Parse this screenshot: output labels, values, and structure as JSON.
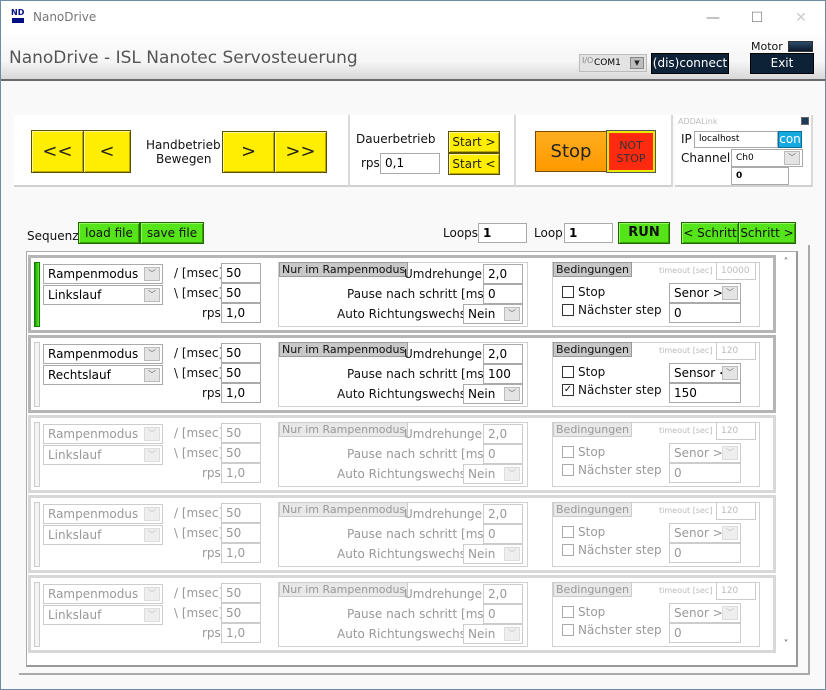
{
  "window": {
    "title": "NanoDrive",
    "icon_text": "ND",
    "controls": {
      "minimize": "—",
      "maximize": "☐",
      "close": "✕"
    }
  },
  "header": {
    "app_title": "NanoDrive - ISL Nanotec Servosteuerung",
    "com_port": {
      "io_glyph": "I/O",
      "value": "COM1",
      "arrow": "▼"
    },
    "connect_label": "(dis)connect",
    "motor_label": "Motor",
    "exit_label": "Exit"
  },
  "manual": {
    "fast_left": "<<",
    "left": "<",
    "label_line1": "Handbetrieb",
    "label_line2": "Bewegen",
    "right": ">",
    "fast_right": ">>"
  },
  "continuous": {
    "title": "Dauerbetrieb",
    "rps_label": "rps",
    "rps_value": "0,1",
    "start_forward": "Start >",
    "start_backward": "Start <"
  },
  "stop": {
    "stop_label": "Stop",
    "not_stop_line1": "NOT",
    "not_stop_line2": "STOP"
  },
  "addalink": {
    "title": "ADDALink",
    "ip_label": "IP",
    "ip_value": "localhost",
    "con_label": "con",
    "channel_label": "Channel",
    "channel_value": "Ch0",
    "reading": "0"
  },
  "sequence": {
    "label": "Sequenz",
    "load_label": "load file",
    "save_label": "save file",
    "loops_label": "Loops",
    "loops_value": "1",
    "loop_label": "Loop",
    "loop_value": "1",
    "run_label": "RUN",
    "prev_step": "< Schritt",
    "next_step": "Schritt >"
  },
  "step_labels": {
    "ramp_up": "/ [msec]",
    "ramp_down": "\\ [msec]",
    "rps": "rps",
    "ramp_only": "Nur im Rampenmodus",
    "revolutions": "Umdrehungen",
    "pause": "Pause nach schritt [msec]",
    "auto_dir": "Auto Richtungswechsel",
    "conditions": "Bedingungen",
    "timeout": "timeout [sec]",
    "stop": "Stop",
    "next_step": "Nächster step"
  },
  "steps": [
    {
      "active": true,
      "enabled": true,
      "mode": "Rampenmodus",
      "direction": "Linkslauf",
      "ramp_up": "50",
      "ramp_down": "50",
      "rps": "1,0",
      "revolutions": "2,0",
      "pause": "0",
      "auto_dir": "Nein",
      "timeout": "10000",
      "stop_checked": false,
      "next_checked": false,
      "sensor": "Senor >",
      "sensor_value": "0"
    },
    {
      "active": false,
      "enabled": true,
      "mode": "Rampenmodus",
      "direction": "Rechtslauf",
      "ramp_up": "50",
      "ramp_down": "50",
      "rps": "1,0",
      "revolutions": "2,0",
      "pause": "100",
      "auto_dir": "Nein",
      "timeout": "120",
      "stop_checked": false,
      "next_checked": true,
      "sensor": "Sensor <",
      "sensor_value": "150"
    },
    {
      "active": false,
      "enabled": false,
      "mode": "Rampenmodus",
      "direction": "Linkslauf",
      "ramp_up": "50",
      "ramp_down": "50",
      "rps": "1,0",
      "revolutions": "2,0",
      "pause": "0",
      "auto_dir": "Nein",
      "timeout": "120",
      "stop_checked": false,
      "next_checked": false,
      "sensor": "Senor >",
      "sensor_value": "0"
    },
    {
      "active": false,
      "enabled": false,
      "mode": "Rampenmodus",
      "direction": "Linkslauf",
      "ramp_up": "50",
      "ramp_down": "50",
      "rps": "1,0",
      "revolutions": "2,0",
      "pause": "0",
      "auto_dir": "Nein",
      "timeout": "120",
      "stop_checked": false,
      "next_checked": false,
      "sensor": "Senor >",
      "sensor_value": "0"
    },
    {
      "active": false,
      "enabled": false,
      "mode": "Rampenmodus",
      "direction": "Linkslauf",
      "ramp_up": "50",
      "ramp_down": "50",
      "rps": "1,0",
      "revolutions": "2,0",
      "pause": "0",
      "auto_dir": "Nein",
      "timeout": "120",
      "stop_checked": false,
      "next_checked": false,
      "sensor": "Senor >",
      "sensor_value": "0"
    }
  ],
  "scrollbar": {
    "up": "˄",
    "down": "˅"
  },
  "colors": {
    "yellow_button": "#ffee00",
    "green_button": "#55e41a",
    "stop_orange": "#ff9900",
    "not_stop_red": "#ff2a10",
    "con_blue": "#16a9e0",
    "dark_button": "#0d2237"
  }
}
